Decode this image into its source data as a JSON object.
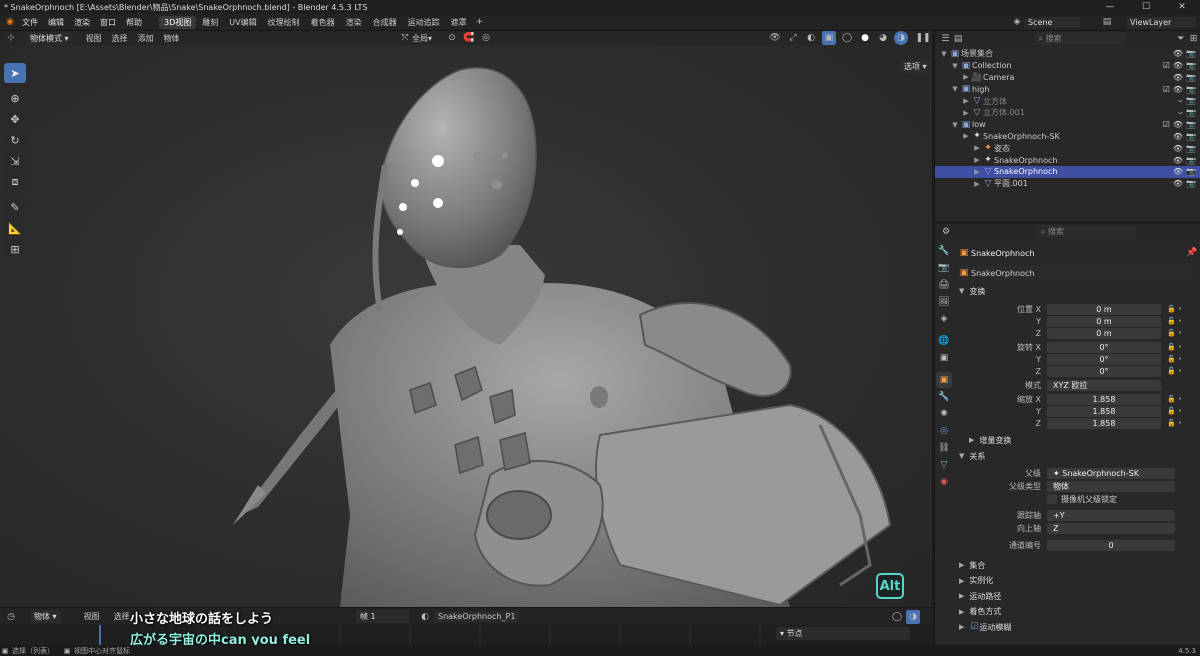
{
  "window": {
    "title": "* SnakeOrphnoch [E:\\Assets\\Blender\\物品\\Snake\\SnakeOrphnoch.blend] - Blender 4.5.3 LTS",
    "minimize": "—",
    "maximize": "☐",
    "close": "✕"
  },
  "menu": {
    "items": [
      "文件",
      "编辑",
      "渲染",
      "窗口",
      "帮助"
    ],
    "icon": "blender-logo-icon"
  },
  "workspaces": [
    {
      "label": "3D视图",
      "active": true
    },
    {
      "label": "雕刻"
    },
    {
      "label": "UV编辑"
    },
    {
      "label": "纹理绘制"
    },
    {
      "label": "着色器"
    },
    {
      "label": "渲染"
    },
    {
      "label": "合成器"
    },
    {
      "label": "运动追踪"
    },
    {
      "label": "遮罩"
    }
  ],
  "scene": {
    "label": "Scene",
    "viewlayer": "ViewLayer"
  },
  "viewport_header": {
    "mode": "物体模式",
    "items": [
      "视图",
      "选择",
      "添加",
      "物体"
    ],
    "transform_orientation": "全局",
    "select_dropdown": "选项"
  },
  "tools": [
    "cursor-select-icon",
    "cursor-icon",
    "move-icon",
    "rotate-icon",
    "scale-icon",
    "transform-icon",
    "annotate-icon",
    "measure-icon",
    "add-cube-icon"
  ],
  "alt_key": "Alt",
  "outliner": {
    "search_placeholder": "搜索",
    "items": [
      {
        "label": "场景集合",
        "indent": 0,
        "type": "collection"
      },
      {
        "label": "Collection",
        "indent": 1,
        "type": "collection"
      },
      {
        "label": "Camera",
        "indent": 2,
        "type": "camera"
      },
      {
        "label": "high",
        "indent": 1,
        "type": "collection"
      },
      {
        "label": "立方体",
        "indent": 2,
        "type": "mesh",
        "muted": true
      },
      {
        "label": "立方体.001",
        "indent": 2,
        "type": "mesh",
        "muted": true
      },
      {
        "label": "low",
        "indent": 1,
        "type": "collection"
      },
      {
        "label": "SnakeOrphnoch-SK",
        "indent": 2,
        "type": "armature"
      },
      {
        "label": "姿态",
        "indent": 3,
        "type": "pose"
      },
      {
        "label": "SnakeOrphnoch",
        "indent": 3,
        "type": "armature"
      },
      {
        "label": "SnakeOrphnoch",
        "indent": 3,
        "type": "mesh",
        "selected": true
      },
      {
        "label": "平面.001",
        "indent": 3,
        "type": "mesh"
      }
    ]
  },
  "properties": {
    "search_placeholder": "搜索",
    "object_name": "SnakeOrphnoch",
    "object_field": "SnakeOrphnoch",
    "transform_header": "变换",
    "location": {
      "label_x": "位置 X",
      "label_y": "Y",
      "label_z": "Z",
      "x": "0 m",
      "y": "0 m",
      "z": "0 m"
    },
    "rotation": {
      "label_x": "旋转 X",
      "label_y": "Y",
      "label_z": "Z",
      "x": "0°",
      "y": "0°",
      "z": "0°"
    },
    "mode": {
      "label": "模式",
      "value": "XYZ 欧拉"
    },
    "scale": {
      "label_x": "缩放 X",
      "label_y": "Y",
      "label_z": "Z",
      "x": "1.858",
      "y": "1.858",
      "z": "1.858"
    },
    "delta": "增量变换",
    "relations_header": "关系",
    "parent": {
      "label": "父级",
      "value": "SnakeOrphnoch-SK"
    },
    "parent_type": {
      "label": "父级类型",
      "value": "物体"
    },
    "camera_lock": "摄像机父级锁定",
    "track_axis": {
      "label": "跟踪轴",
      "value": "+Y"
    },
    "up_axis": {
      "label": "向上轴",
      "value": "Z"
    },
    "pass_index": {
      "label": "通道编号",
      "value": "0"
    },
    "collapsed": [
      "集合",
      "实例化",
      "运动路径",
      "着色方式",
      "运动模糊"
    ],
    "version": "4.5.3"
  },
  "timeline": {
    "mode": "物体",
    "items": [
      "视图",
      "选择"
    ],
    "frame_label": "帧 1",
    "action": "SnakeOrphnoch_P1",
    "keying": "节点"
  },
  "subtitles": {
    "line1": "小さな地球の話をしよう",
    "line2": "広がる宇宙の中can you feel"
  },
  "status": {
    "left": "SnakeOrphnoch",
    "select": "选择（列表）",
    "center": "视图中心对齐鼠标"
  }
}
